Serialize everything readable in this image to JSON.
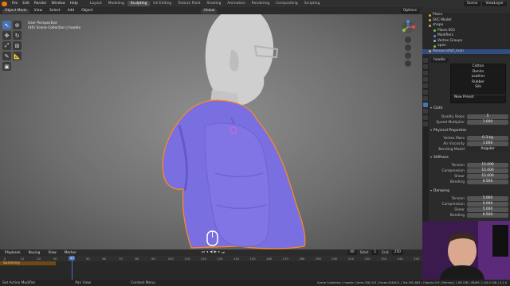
{
  "menu": [
    "File",
    "Edit",
    "Render",
    "Window",
    "Help"
  ],
  "workspaces": [
    {
      "label": "Layout",
      "active": false
    },
    {
      "label": "Modeling",
      "active": false
    },
    {
      "label": "Sculpting",
      "active": true
    },
    {
      "label": "UV Editing",
      "active": false
    },
    {
      "label": "Texture Paint",
      "active": false
    },
    {
      "label": "Shading",
      "active": false
    },
    {
      "label": "Animation",
      "active": false
    },
    {
      "label": "Rendering",
      "active": false
    },
    {
      "label": "Compositing",
      "active": false
    },
    {
      "label": "Scripting",
      "active": false
    }
  ],
  "scene": {
    "name": "Scene",
    "view_layer": "ViewLayer"
  },
  "viewport_header": {
    "mode": "Object Mode",
    "menus": [
      "View",
      "Select",
      "Add",
      "Object"
    ],
    "orientation": "Global",
    "options_label": "Options"
  },
  "viewport_info": {
    "line1": "User Perspective",
    "line2": "(40) Scene Collection | hoodie"
  },
  "toolbar_tools": [
    "select-icon",
    "cursor-icon",
    "move-icon",
    "rotate-icon",
    "scale-icon",
    "transform-icon",
    "annotate-icon",
    "measure-icon",
    "add-cube-icon"
  ],
  "outliner": {
    "rows": [
      {
        "label": "Plane",
        "indent": 1,
        "selected": false
      },
      {
        "label": "SVC Model",
        "indent": 1,
        "selected": false
      },
      {
        "label": "shape",
        "indent": 1,
        "selected": false
      },
      {
        "label": "Plane.003",
        "indent": 2,
        "selected": false
      },
      {
        "label": "Modifiers",
        "indent": 2,
        "selected": false
      },
      {
        "label": "Vertex Groups",
        "indent": 2,
        "selected": false
      },
      {
        "label": "open",
        "indent": 2,
        "selected": false
      },
      {
        "label": "Resourcefall_man",
        "indent": 1,
        "selected": true
      }
    ]
  },
  "properties": {
    "object_name": "hoodie",
    "preset_menu": [
      "Cotton",
      "Denim",
      "Leather",
      "Rubber",
      "Silk"
    ],
    "new_preset": "New Preset",
    "cloth_title": "Cloth",
    "quality_steps": {
      "label": "Quality Steps",
      "value": "5"
    },
    "speed_multiplier": {
      "label": "Speed Multiplier",
      "value": "1.000"
    },
    "physical_title": "Physical Properties",
    "vertex_mass": {
      "label": "Vertex Mass",
      "value": "0.3 kg"
    },
    "air_viscosity": {
      "label": "Air Viscosity",
      "value": "1.000"
    },
    "bending_model": {
      "label": "Bending Model",
      "value": "Angular"
    },
    "stiffness_title": "Stiffness",
    "stiffness": [
      {
        "label": "Tension",
        "value": "15.000"
      },
      {
        "label": "Compression",
        "value": "15.000"
      },
      {
        "label": "Shear",
        "value": "15.000"
      },
      {
        "label": "Bending",
        "value": "0.500"
      }
    ],
    "damping_title": "Damping",
    "damping": [
      {
        "label": "Tension",
        "value": "5.000"
      },
      {
        "label": "Compression",
        "value": "5.000"
      },
      {
        "label": "Shear",
        "value": "5.000"
      },
      {
        "label": "Bending",
        "value": "0.500"
      }
    ]
  },
  "timeline_header": {
    "menus": [
      "Playback",
      "Keying",
      "View",
      "Marker"
    ],
    "current_frame": "40",
    "start_label": "Start",
    "start_value": "1",
    "end_label": "End",
    "end_value": "250"
  },
  "timeline": {
    "ticks": [
      "0",
      "10",
      "20",
      "30",
      "40",
      "50",
      "60",
      "70",
      "80",
      "90",
      "100",
      "110",
      "120",
      "130",
      "140",
      "150",
      "160",
      "170",
      "180",
      "190",
      "200",
      "210",
      "220",
      "230",
      "240",
      "250"
    ],
    "playhead": "40",
    "summary": "Summary"
  },
  "statusbar": {
    "left": "Set Active Modifier",
    "middle": "Pan View",
    "right_hint": "Context Menu",
    "stats": "Scene Collection | hoodie | Verts:338,313 | Faces:338,821 | Tris:395,883 | Objects:1/9 | Memory: 1.68 GiB | VRAM: 2.1/8.0 GiB | 3.1.0"
  },
  "colors": {
    "accent": "#4772b3",
    "hoodie": "#7a6fe0",
    "selection_outline": "#ff8a1c",
    "summary_bar": "#6b4a14"
  }
}
